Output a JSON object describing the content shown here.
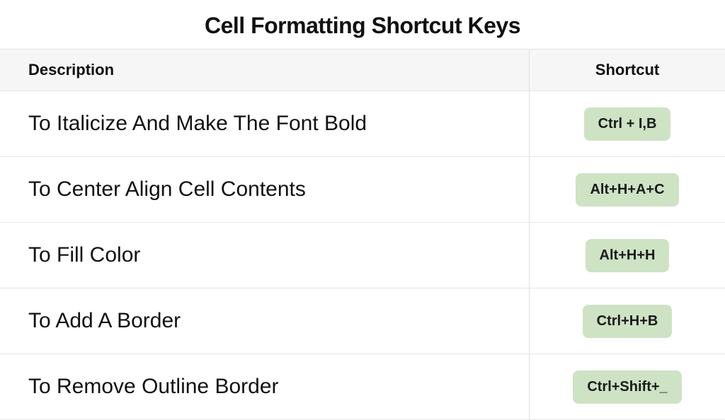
{
  "title": "Cell Formatting Shortcut Keys",
  "headers": {
    "description": "Description",
    "shortcut": "Shortcut"
  },
  "rows": [
    {
      "description": "To Italicize And Make The Font Bold",
      "shortcut": "Ctrl + I,B"
    },
    {
      "description": "To Center Align Cell Contents",
      "shortcut": "Alt+H+A+C"
    },
    {
      "description": "To Fill Color",
      "shortcut": "Alt+H+H"
    },
    {
      "description": "To Add A Border",
      "shortcut": "Ctrl+H+B"
    },
    {
      "description": "To Remove Outline Border",
      "shortcut": "Ctrl+Shift+_"
    }
  ]
}
